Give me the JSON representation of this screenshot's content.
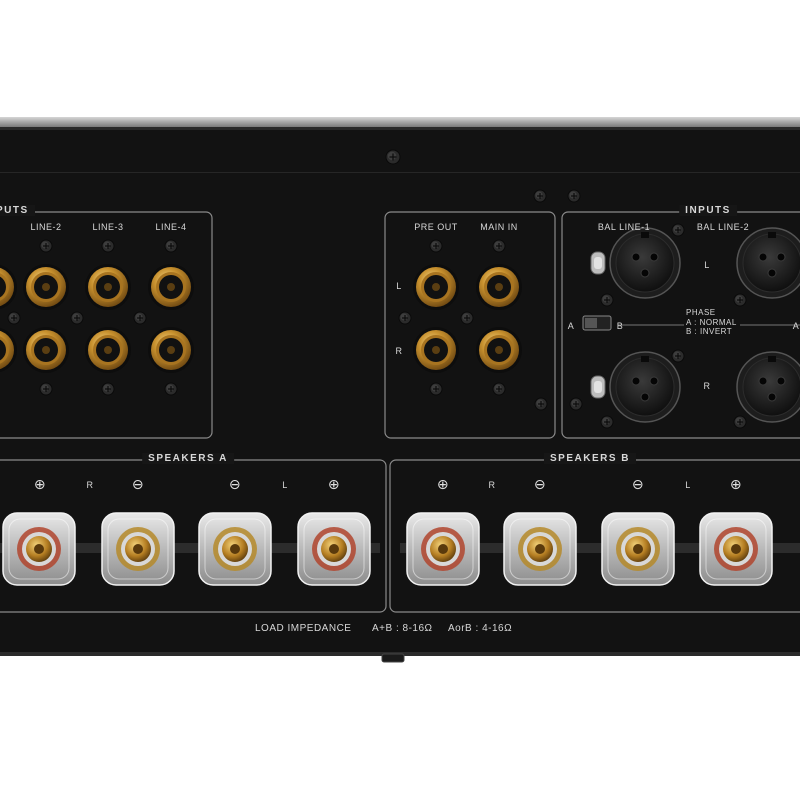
{
  "inputs_rca": {
    "header": "PUTS",
    "line_labels": [
      "LINE-2",
      "LINE-3",
      "LINE-4"
    ]
  },
  "pre_main": {
    "pre_out_label": "PRE OUT",
    "main_in_label": "MAIN IN",
    "left_label": "L",
    "right_label": "R"
  },
  "inputs_xlr": {
    "header": "INPUTS",
    "bal_line_1": "BAL LINE-1",
    "bal_line_2": "BAL LINE-2",
    "left_label": "L",
    "right_label": "R",
    "switch_a": "A",
    "switch_b": "B",
    "phase_title": "PHASE",
    "phase_a": "A : NORMAL",
    "phase_b": "B : INVERT",
    "edge_a": "A"
  },
  "speakers_a": {
    "header": "SPEAKERS A",
    "symbols": [
      "⊕",
      "R",
      "⊖",
      "⊖",
      "L",
      "⊕"
    ]
  },
  "speakers_b": {
    "header": "SPEAKERS B",
    "symbols": [
      "⊕",
      "R",
      "⊖",
      "⊖",
      "L",
      "⊕"
    ]
  },
  "footer": {
    "load_impedance": "LOAD  IMPEDANCE",
    "a_plus_b": "A+B : 8-16Ω",
    "a_or_b": "AorB : 4-16Ω"
  },
  "colors": {
    "panel": "#141414",
    "outline": "#8a8a8a",
    "gold": "#c8912e",
    "text": "#d8d8d8"
  }
}
